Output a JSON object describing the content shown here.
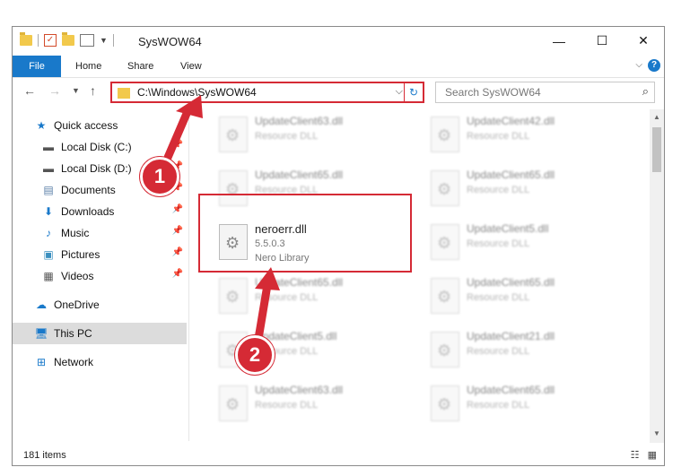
{
  "window": {
    "title": "SysWOW64"
  },
  "ribbon": {
    "tabs": [
      "File",
      "Home",
      "Share",
      "View"
    ]
  },
  "address": {
    "path": "C:\\Windows\\SysWOW64"
  },
  "search": {
    "placeholder": "Search SysWOW64"
  },
  "sidebar": {
    "items": [
      {
        "label": "Quick access",
        "icon": "star-icon"
      },
      {
        "label": "Local Disk (C:)",
        "icon": "drive-icon"
      },
      {
        "label": "Local Disk (D:)",
        "icon": "drive-icon"
      },
      {
        "label": "Documents",
        "icon": "documents-icon"
      },
      {
        "label": "Downloads",
        "icon": "download-icon"
      },
      {
        "label": "Music",
        "icon": "music-icon"
      },
      {
        "label": "Pictures",
        "icon": "pictures-icon"
      },
      {
        "label": "Videos",
        "icon": "videos-icon"
      },
      {
        "label": "OneDrive",
        "icon": "cloud-icon"
      },
      {
        "label": "This PC",
        "icon": "computer-icon"
      },
      {
        "label": "Network",
        "icon": "network-icon"
      }
    ]
  },
  "files": [
    {
      "name": "UpdateClient63.dll",
      "desc": "Resource DLL"
    },
    {
      "name": "UpdateClient42.dll",
      "desc": "Resource DLL"
    },
    {
      "name": "UpdateClient65.dll",
      "desc": "Resource DLL"
    },
    {
      "name": "UpdateClient65.dll",
      "desc": "Resource DLL"
    },
    {
      "name": "neroerr.dll",
      "version": "5.5.0.3",
      "desc": "Nero Library"
    },
    {
      "name": "UpdateClient5.dll",
      "desc": "Resource DLL"
    },
    {
      "name": "UpdateClient65.dll",
      "desc": "Resource DLL"
    },
    {
      "name": "UpdateClient65.dll",
      "desc": "Resource DLL"
    },
    {
      "name": "UpdateClient5.dll",
      "desc": "Resource DLL"
    },
    {
      "name": "UpdateClient21.dll",
      "desc": "Resource DLL"
    },
    {
      "name": "UpdateClient63.dll",
      "desc": "Resource DLL"
    },
    {
      "name": "UpdateClient65.dll",
      "desc": "Resource DLL"
    }
  ],
  "status": {
    "count": "181 items"
  },
  "callouts": [
    "1",
    "2"
  ],
  "colors": {
    "accent": "#1979ca",
    "highlight": "#d52a35"
  }
}
